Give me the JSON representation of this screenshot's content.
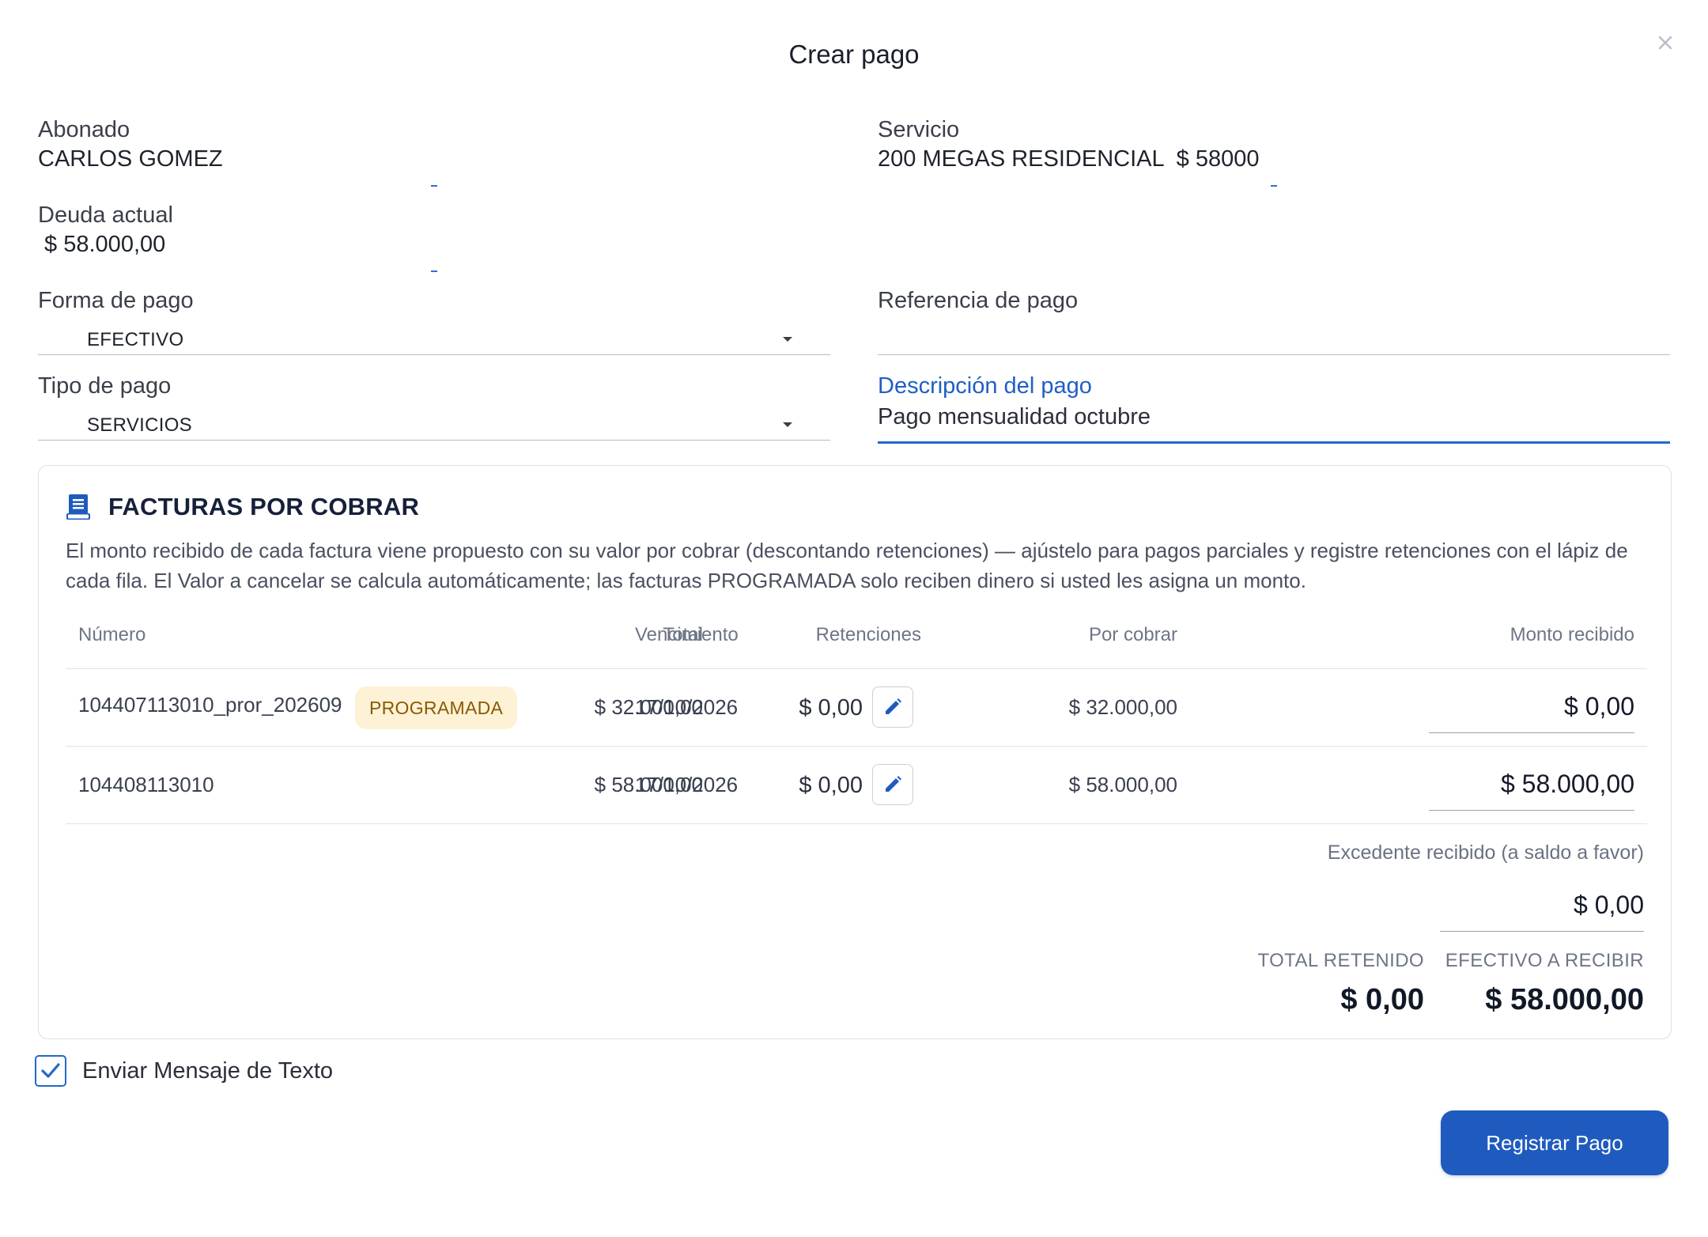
{
  "dialog": {
    "title": "Crear pago",
    "close_icon": "close-icon"
  },
  "fields": {
    "abonado": {
      "label": "Abonado",
      "value": "CARLOS GOMEZ"
    },
    "servicio": {
      "label": "Servicio",
      "value": "200 MEGAS RESIDENCIAL  $ 58000"
    },
    "deuda": {
      "label": "Deuda actual",
      "value": " $ 58.000,00"
    },
    "forma_pago": {
      "label": "Forma de pago",
      "value": "EFECTIVO"
    },
    "referencia": {
      "label": "Referencia de pago",
      "value": ""
    },
    "tipo_pago": {
      "label": "Tipo de pago",
      "value": "SERVICIOS"
    },
    "descripcion": {
      "label": "Descripción del pago",
      "value": "Pago mensualidad octubre"
    }
  },
  "invoices": {
    "icon": "receipt-icon",
    "title": "FACTURAS POR COBRAR",
    "description": "El monto recibido de cada factura viene propuesto con su valor por cobrar (descontando retenciones) — ajústelo para pagos parciales y registre retenciones con el lápiz de cada fila. El Valor a cancelar se calcula automáticamente; las facturas PROGRAMADA solo reciben dinero si usted les asigna un monto.",
    "columns": {
      "numero": "Número",
      "vencimiento": "Vencimiento",
      "total": "Total",
      "retenciones": "Retenciones",
      "por_cobrar": "Por cobrar",
      "monto": "Monto recibido"
    },
    "rows": [
      {
        "numero": "104407113010_pror_202609",
        "badge": "PROGRAMADA",
        "vencimiento": "17/10/2026",
        "total": "$ 32.000,00",
        "retenciones": "$ 0,00",
        "por_cobrar": "$ 32.000,00",
        "monto": "$ 0,00"
      },
      {
        "numero": "104408113010",
        "badge": "",
        "vencimiento": "17/10/2026",
        "total": "$ 58.000,00",
        "retenciones": "$ 0,00",
        "por_cobrar": "$ 58.000,00",
        "monto": "$ 58.000,00"
      }
    ],
    "excess_label": "Excedente recibido (a saldo a favor)",
    "excess_value": "$ 0,00",
    "total_retenido_label": "TOTAL RETENIDO",
    "total_retenido_value": "$ 0,00",
    "efectivo_label": "EFECTIVO A RECIBIR",
    "efectivo_value": "$ 58.000,00"
  },
  "sms": {
    "label": "Enviar Mensaje de Texto",
    "checked": true
  },
  "actions": {
    "submit_label": "Registrar Pago"
  },
  "colors": {
    "primary": "#1f5bbf",
    "accent_blue": "#2468c8",
    "badge_bg": "#fdf2d6",
    "badge_text": "#8a5a00"
  }
}
